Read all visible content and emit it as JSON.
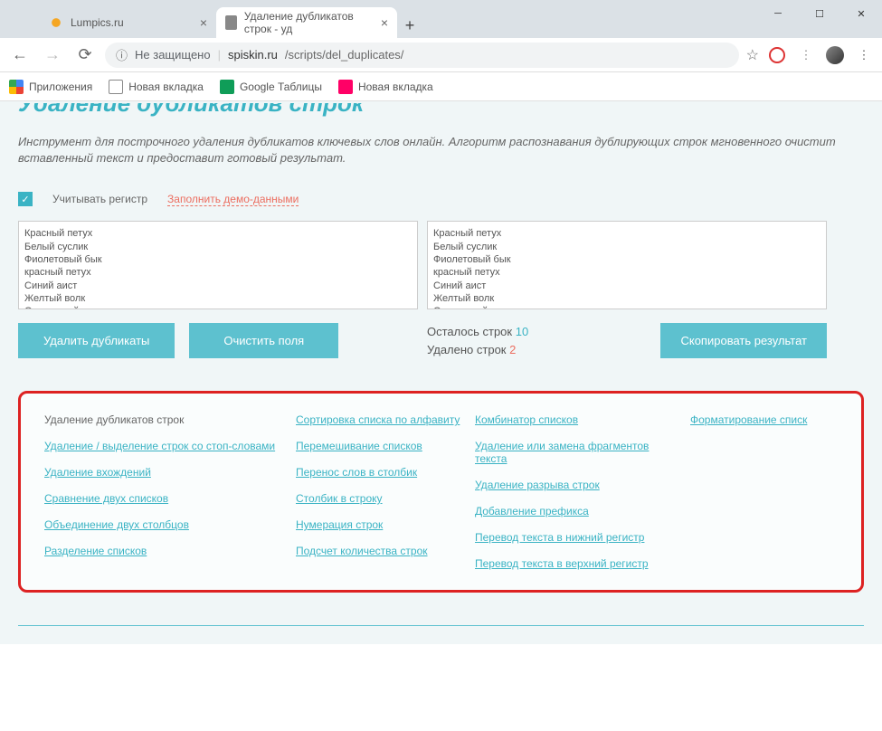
{
  "chrome": {
    "tabs": [
      {
        "label": "Lumpics.ru",
        "active": false
      },
      {
        "label": "Удаление дубликатов строк - уд",
        "active": true
      }
    ],
    "url_insecure": "Не защищено",
    "url_host": "spiskin.ru",
    "url_path": "/scripts/del_duplicates/",
    "bookmarks": {
      "apps": "Приложения",
      "new1": "Новая вкладка",
      "sheets": "Google Таблицы",
      "new2": "Новая вкладка"
    }
  },
  "page": {
    "title": "Удаление дубликатов строк",
    "description": "Инструмент для построчного удаления дубликатов ключевых слов онлайн. Алгоритм распознавания дублирующих строк мгновенного очистит вставленный текст и предоставит готовый результат.",
    "case_checkbox_label": "Учитывать регистр",
    "demo_link": "Заполнить демо-данными",
    "input_text": "Красный петух\nБелый суслик\nФиолетовый бык\nкрасный петух\nСиний аист\nЖелтый волк\nОранжевый медведь\nСиний аист",
    "output_text": "Красный петух\nБелый суслик\nФиолетовый бык\nкрасный петух\nСиний аист\nЖелтый волк\nОранжевый медведь\nЧерный страус",
    "btn_remove": "Удалить дубликаты",
    "btn_clear": "Очистить поля",
    "btn_copy": "Скопировать результат",
    "stats": {
      "remaining_label": "Осталось строк",
      "remaining_value": "10",
      "removed_label": "Удалено строк",
      "removed_value": "2"
    }
  },
  "related": {
    "col1": [
      "Удаление дубликатов строк",
      "Удаление / выделение строк со стоп-словами",
      "Удаление вхождений",
      "Сравнение двух списков",
      "Объединение двух столбцов",
      "Разделение списков"
    ],
    "col2": [
      "Сортировка списка по алфавиту",
      "Перемешивание списков",
      "Перенос слов в столбик",
      "Столбик в строку",
      "Нумерация строк",
      "Подсчет количества строк"
    ],
    "col3": [
      "Комбинатор списков",
      "Удаление или замена фрагментов текста",
      "Удаление разрыва строк",
      "Добавление префикса",
      "Перевод текста в нижний регистр",
      "Перевод текста в верхний регистр"
    ],
    "col4": [
      "Форматирование списк"
    ]
  }
}
